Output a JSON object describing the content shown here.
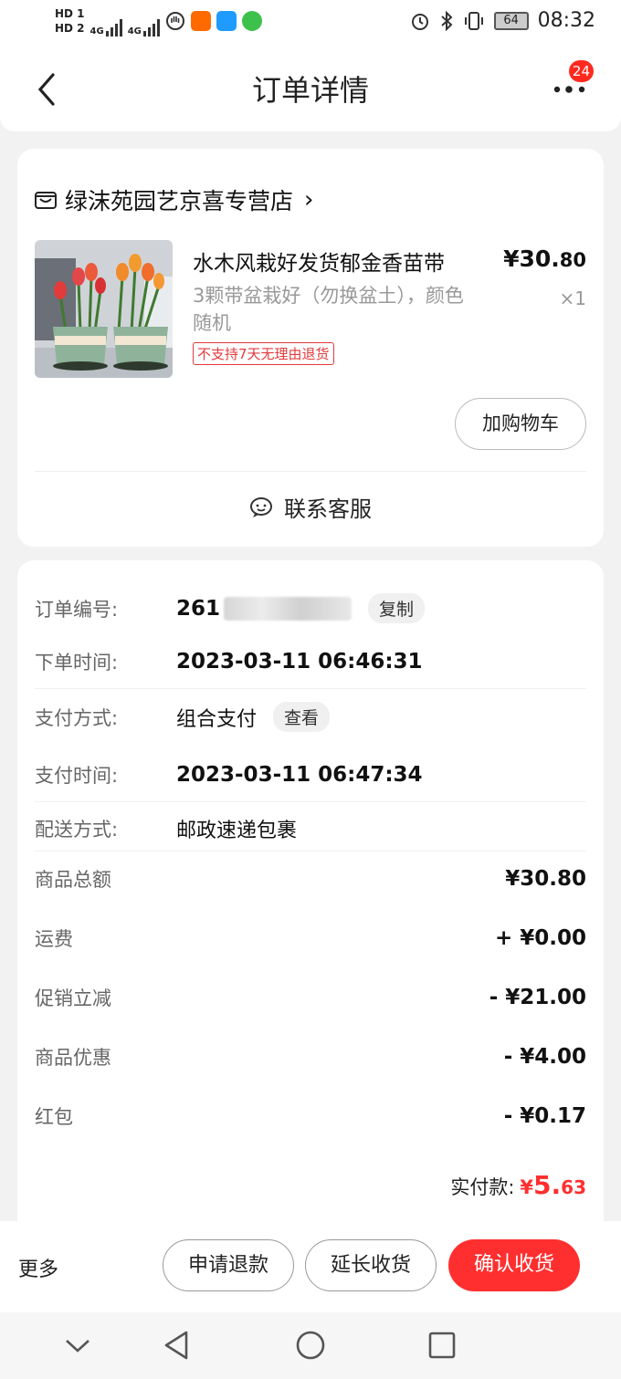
{
  "status_bar": {
    "hd1": "HD 1",
    "hd2": "HD 2",
    "signal1": "4G",
    "signal2": "4G",
    "battery": "64",
    "time": "08:32"
  },
  "header": {
    "title": "订单详情",
    "badge_count": "24"
  },
  "shop": {
    "name": "绿沫苑园艺京喜专营店",
    "chevron": "›"
  },
  "product": {
    "title": "水木风栽好发货郁金香苗带",
    "spec": "3颗带盆栽好（勿换盆土），颜色随机",
    "tag": "不支持7天无理由退货",
    "price_main": "¥30.",
    "price_cents": "80",
    "qty": "×1",
    "add_cart": "加购物车"
  },
  "customer_service": "联系客服",
  "order_info": {
    "order_no_label": "订单编号:",
    "order_no": "261",
    "copy": "复制",
    "order_time_label": "下单时间:",
    "order_time": "2023-03-11 06:46:31",
    "pay_method_label": "支付方式:",
    "pay_method": "组合支付",
    "view": "查看",
    "pay_time_label": "支付时间:",
    "pay_time": "2023-03-11 06:47:34",
    "delivery_label": "配送方式:",
    "delivery": "邮政速递包裹"
  },
  "amounts": [
    {
      "label": "商品总额",
      "value": "¥30.80"
    },
    {
      "label": "运费",
      "value": "+ ¥0.00"
    },
    {
      "label": "促销立减",
      "value": "- ¥21.00"
    },
    {
      "label": "商品优惠",
      "value": "- ¥4.00"
    },
    {
      "label": "红包",
      "value": "- ¥0.17"
    }
  ],
  "paid": {
    "label": "实付款:",
    "currency": "¥",
    "main": "5.",
    "cents": "63"
  },
  "bottom": {
    "more": "更多",
    "refund": "申请退款",
    "extend": "延长收货",
    "confirm": "确认收货"
  },
  "colors": {
    "accent": "#ff2f2f",
    "price_red": "#e4393c"
  }
}
